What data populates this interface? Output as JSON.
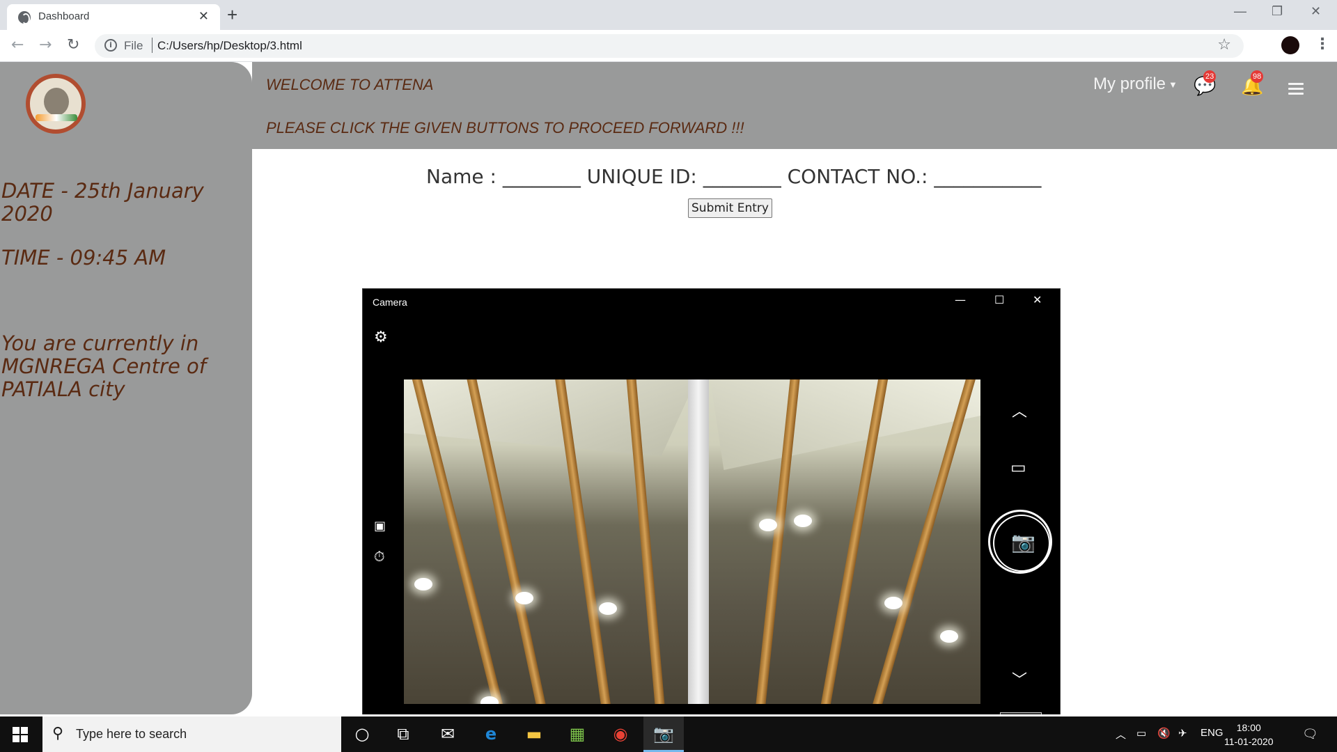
{
  "browser": {
    "tab_title": "Dashboard",
    "tab_close": "✕",
    "new_tab": "+",
    "url_scheme": "File",
    "url": "C:/Users/hp/Desktop/3.html",
    "window_controls": [
      "—",
      "❐",
      "✕"
    ]
  },
  "sidebar": {
    "date": "DATE - 25th January 2020",
    "time": "TIME - 09:45 AM",
    "location": "You are currently in MGNREGA Centre of PATIALA city"
  },
  "header": {
    "welcome": "WELCOME TO ATTENA",
    "instruction": "PLEASE CLICK THE GIVEN BUTTONS TO PROCEED FORWARD !!!",
    "profile_label": "My profile",
    "messages_count": "23",
    "notifications_count": "98"
  },
  "form": {
    "line": "Name : ________ UNIQUE ID: ________ CONTACT NO.: ___________",
    "submit_label": "Submit Entry"
  },
  "camera_window": {
    "title": "Camera"
  },
  "taskbar": {
    "search_placeholder": "Type here to search",
    "language": "ENG",
    "time": "18:00",
    "date": "11-01-2020"
  }
}
